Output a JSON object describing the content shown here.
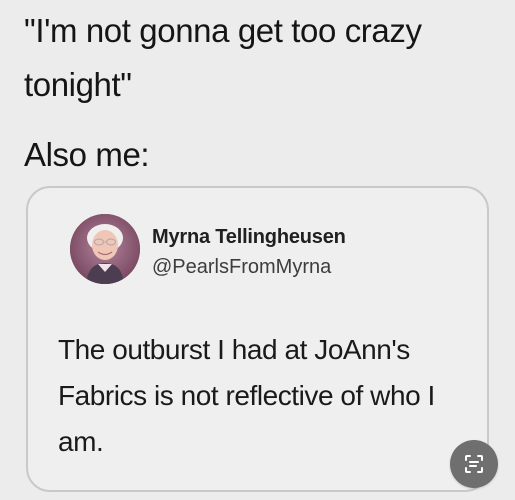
{
  "meme": {
    "top_caption": "\"I'm not gonna get too crazy tonight\"",
    "also_me": "Also me:"
  },
  "tweet": {
    "display_name": "Myrna Tellingheusen",
    "handle": "@PearlsFromMyrna",
    "body": "The outburst I had at JoAnn's Fabrics is not reflective of who I am.",
    "avatar_icon": "avatar-photo"
  },
  "overlay": {
    "scan_icon": "text-scan-icon",
    "scan_button_color": "#6f6f6f"
  }
}
